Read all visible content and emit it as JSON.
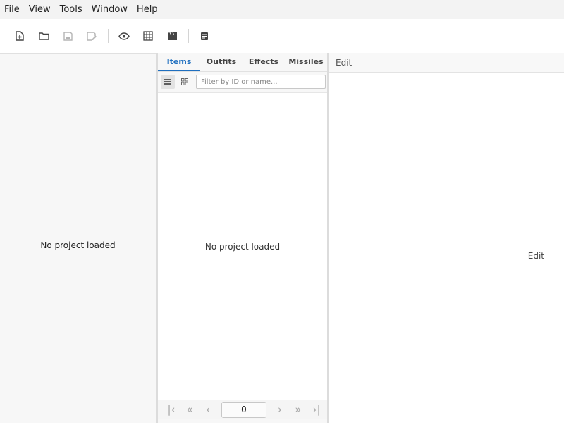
{
  "menu": [
    "File",
    "View",
    "Tools",
    "Window",
    "Help"
  ],
  "toolbar": {
    "buttons": [
      "new-project-icon",
      "open-folder-icon",
      "save-icon",
      "save-as-icon",
      "preview-eye-icon",
      "grid-icon",
      "animation-clapper-icon",
      "document-icon"
    ]
  },
  "left_panel": {
    "empty_text": "No project loaded"
  },
  "middle_panel": {
    "tabs": [
      "Items",
      "Outfits",
      "Effects",
      "Missiles"
    ],
    "active_tab": "Items",
    "filter_placeholder": "Filter by ID or name...",
    "empty_text": "No project loaded",
    "pager": {
      "first": "|‹",
      "prev_many": "«",
      "prev": "‹",
      "page": "0",
      "next": "›",
      "next_many": "»",
      "last": "›|"
    }
  },
  "right_panel": {
    "header": "Edit",
    "body_text": "Edit"
  },
  "colors": {
    "accent": "#1f6fbf",
    "background": "#f7f7f7",
    "panel": "#ffffff"
  }
}
